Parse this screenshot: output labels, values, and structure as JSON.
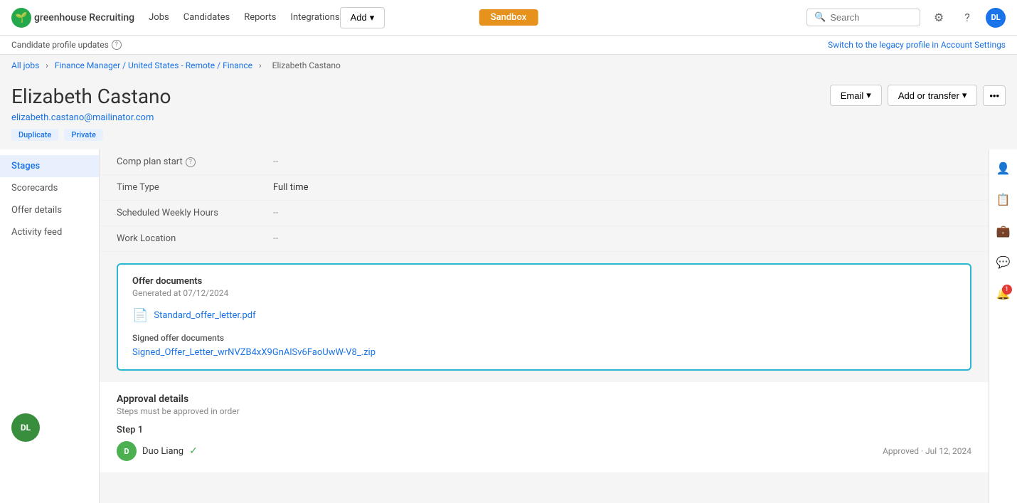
{
  "nav": {
    "logo_text": "greenhouse Recruiting",
    "links": [
      "Jobs",
      "Candidates",
      "Reports",
      "Integrations"
    ],
    "add_label": "Add",
    "sandbox_label": "Sandbox",
    "search_placeholder": "Search",
    "avatar_initials": "DL"
  },
  "updates_bar": {
    "label": "Candidate profile updates",
    "help_tooltip": "?",
    "legacy_link": "Switch to the legacy profile in Account Settings"
  },
  "breadcrumb": {
    "all_jobs": "All jobs",
    "job_link": "Finance Manager / United States - Remote / Finance",
    "candidate": "Elizabeth Castano"
  },
  "candidate": {
    "name": "Elizabeth Castano",
    "email": "elizabeth.castano@mailinator.com",
    "tag_duplicate": "Duplicate",
    "tag_private": "Private"
  },
  "header_actions": {
    "email_label": "Email",
    "transfer_label": "Add or transfer",
    "more_icon": "•••"
  },
  "sidebar": {
    "items": [
      {
        "label": "Stages",
        "active": true
      },
      {
        "label": "Scorecards",
        "active": false
      },
      {
        "label": "Offer details",
        "active": false
      },
      {
        "label": "Activity feed",
        "active": false
      }
    ]
  },
  "fields": [
    {
      "label": "Comp plan start",
      "has_help": true,
      "value": "--",
      "muted": true
    },
    {
      "label": "Time Type",
      "has_help": false,
      "value": "Full time",
      "muted": false
    },
    {
      "label": "Scheduled Weekly Hours",
      "has_help": false,
      "value": "--",
      "muted": true
    },
    {
      "label": "Work Location",
      "has_help": false,
      "value": "--",
      "muted": true
    }
  ],
  "offer_docs": {
    "title": "Offer documents",
    "date_label": "Generated at 07/12/2024",
    "file_name": "Standard_offer_letter.pdf",
    "signed_label": "Signed offer documents",
    "signed_file": "Signed_Offer_Letter_wrNVZB4xX9GnAlSv6FaoUwW-V8_.zip"
  },
  "approval": {
    "title": "Approval details",
    "subtitle": "Steps must be approved in order",
    "step_label": "Step 1",
    "user_initial": "D",
    "user_name": "Duo Liang",
    "approved_text": "Approved · Jul 12, 2024"
  },
  "right_panel": {
    "icons": [
      "person",
      "document",
      "briefcase",
      "chat",
      "bell"
    ],
    "notification_count": "1"
  }
}
